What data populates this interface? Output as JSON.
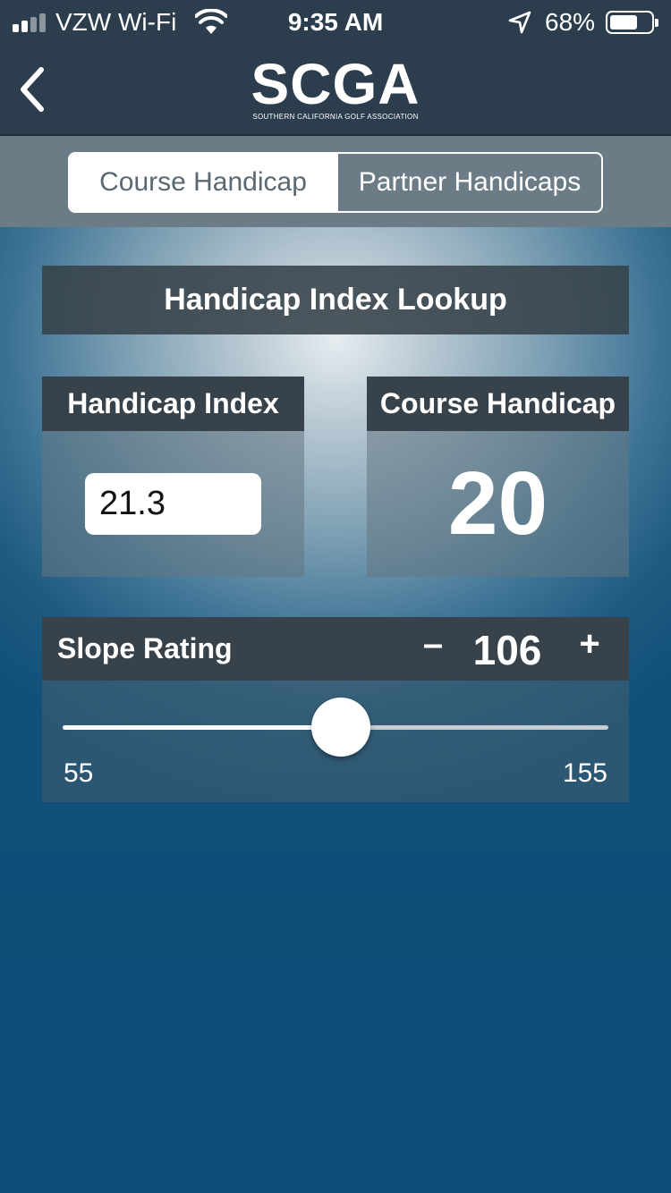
{
  "status_bar": {
    "carrier": "VZW Wi-Fi",
    "time": "9:35 AM",
    "battery_percent": "68%",
    "battery_level": 0.68,
    "icons": [
      "signal-icon",
      "wifi-icon",
      "location-arrow-icon",
      "battery-icon"
    ]
  },
  "nav": {
    "back_icon": "chevron-left-icon",
    "logo_mark": "SCGA",
    "logo_subtitle": "SOUTHERN CALIFORNIA GOLF ASSOCIATION"
  },
  "tabs": {
    "items": [
      {
        "label": "Course Handicap",
        "selected": true
      },
      {
        "label": "Partner Handicaps",
        "selected": false
      }
    ]
  },
  "lookup": {
    "title": "Handicap Index Lookup",
    "index_label": "Handicap Index",
    "index_value": "21.3",
    "course_label": "Course Handicap",
    "course_value": "20"
  },
  "slope": {
    "label": "Slope Rating",
    "decrement": "–",
    "increment": "+",
    "value": 106,
    "min": 55,
    "max": 155
  },
  "colors": {
    "bar": "#2c3e4d",
    "panel_header": "#37424b",
    "background_deep": "#0f4f78"
  }
}
